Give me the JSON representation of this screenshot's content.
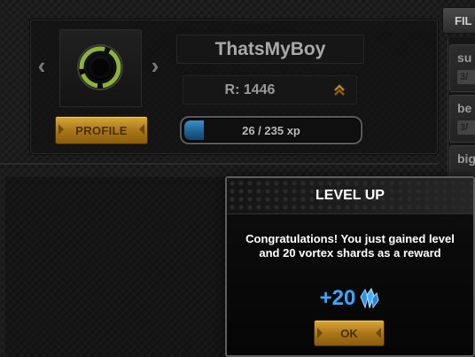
{
  "player": {
    "name": "ThatsMyBoy",
    "rating": "R: 1446",
    "profile_label": "PROFILE",
    "avatar_icon": "vortex-ring-icon",
    "rank_icon": "double-chevron-up-icon"
  },
  "xp": {
    "text": "26 / 235 xp",
    "current": 26,
    "max": 235
  },
  "sidebar": {
    "filter_label": "FIL",
    "items": [
      {
        "name": "su",
        "sub": "3/"
      },
      {
        "name": "be",
        "sub": "3/"
      },
      {
        "name": "big",
        "sub": ""
      }
    ]
  },
  "dialog": {
    "title": "LEVEL UP",
    "message": "Congratulations! You just gained level and 20 vortex shards as a reward",
    "reward_amount": "+20",
    "reward_icon": "crystal-shard-icon",
    "ok_label": "OK"
  },
  "colors": {
    "gold_button": "#b8821f",
    "xp_fill": "#1f6aa0",
    "reward_blue": "#3aa6ff",
    "avatar_ring": "#8bb33a"
  }
}
